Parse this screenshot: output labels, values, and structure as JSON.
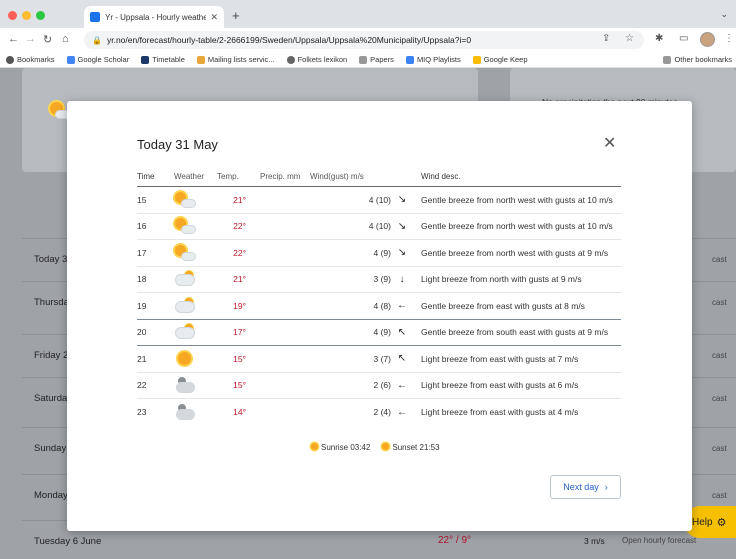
{
  "browser": {
    "tab_title": "Yr - Uppsala - Hourly weather",
    "url": "yr.no/en/forecast/hourly-table/2-2666199/Sweden/Uppsala/Uppsala%20Municipality/Uppsala?i=0",
    "bookmarks": [
      "Bookmarks",
      "Google Scholar",
      "Timetable",
      "Mailing lists servic...",
      "Folkets lexikon",
      "Papers",
      "MIQ Playlists",
      "Google Keep"
    ],
    "other_bookmarks": "Other bookmarks"
  },
  "background": {
    "no_precip": "No precipitation the next 90 minutes",
    "days": [
      "Today 3",
      "Thursda",
      "Friday 2",
      "Saturda",
      "Sunday",
      "Monday",
      "Tuesday 6 June"
    ],
    "forecast_label": "cast",
    "last_row": {
      "temp": "22° / 9°",
      "wind": "3 m/s",
      "link": "Open hourly forecast"
    },
    "help": "Help"
  },
  "modal": {
    "title": "Today 31 May",
    "columns": [
      "Time",
      "Weather",
      "Temp.",
      "Precip. mm",
      "Wind(gust) m/s",
      "Wind desc."
    ],
    "rows": [
      {
        "time": "15",
        "icon": "sun-cloud",
        "temp": "21°",
        "wind": "4 (10)",
        "arrow": "↘",
        "desc": "Gentle breeze from north west with gusts at 10 m/s"
      },
      {
        "time": "16",
        "icon": "sun-cloud",
        "temp": "22°",
        "wind": "4 (10)",
        "arrow": "↘",
        "desc": "Gentle breeze from north west with gusts at 10 m/s"
      },
      {
        "time": "17",
        "icon": "sun-cloud",
        "temp": "22°",
        "wind": "4 (9)",
        "arrow": "↘",
        "desc": "Gentle breeze from north west with gusts at 9 m/s"
      },
      {
        "time": "18",
        "icon": "cloud-sun",
        "temp": "21°",
        "wind": "3 (9)",
        "arrow": "↓",
        "desc": "Light breeze from north with gusts at 9 m/s"
      },
      {
        "time": "19",
        "icon": "cloud-sun",
        "temp": "19°",
        "wind": "4 (8)",
        "arrow": "←",
        "desc": "Gentle breeze from east with gusts at 8 m/s"
      },
      {
        "time": "20",
        "icon": "cloud-sun",
        "temp": "17°",
        "wind": "4 (9)",
        "arrow": "↖",
        "desc": "Gentle breeze from south east with gusts at 9 m/s"
      },
      {
        "time": "21",
        "icon": "sun",
        "temp": "15°",
        "wind": "3 (7)",
        "arrow": "↖",
        "desc": "Light breeze from east with gusts at 7 m/s"
      },
      {
        "time": "22",
        "icon": "cloud-moon",
        "temp": "15°",
        "wind": "2 (6)",
        "arrow": "←",
        "desc": "Light breeze from east with gusts at 6 m/s"
      },
      {
        "time": "23",
        "icon": "cloud-moon",
        "temp": "14°",
        "wind": "2 (4)",
        "arrow": "←",
        "desc": "Light breeze from east with gusts at 4 m/s"
      }
    ],
    "sunrise": "Sunrise 03:42",
    "sunset": "Sunset 21:53",
    "next_day": "Next day"
  },
  "colors": {
    "temp_warm": "#c4162a",
    "link": "#2563c7",
    "help": "#f6c000"
  }
}
